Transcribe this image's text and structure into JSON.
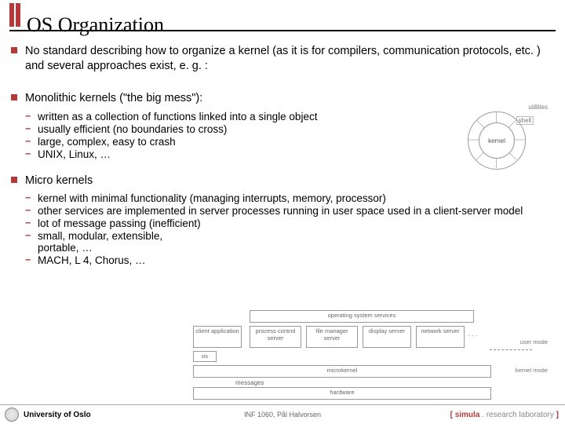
{
  "title": "OS Organization",
  "b1": "No standard describing how to organize a kernel (as it is for compilers, communication protocols, etc. ) and several approaches exist, e. g. :",
  "b2": "Monolithic kernels (\"the big mess\"):",
  "b2s": [
    "written as a collection of functions linked into a single object",
    "usually efficient (no boundaries to cross)",
    "large, complex, easy to crash",
    "UNIX, Linux, …"
  ],
  "b3": "Micro kernels",
  "b3s": [
    "kernel with minimal functionality (managing interrupts, memory, processor)",
    "other services are implemented in server processes running in user space used in a client-server model",
    "lot of message passing (inefficient)",
    "small, modular, extensible, portable, …",
    "MACH, L 4, Chorus, …"
  ],
  "d1": {
    "utilities": "utilities",
    "shell": "shell",
    "kernel": "kernel"
  },
  "d2": {
    "top": "operating system services",
    "ca": "client application",
    "pc": "process control server",
    "fm": "file manager server",
    "ds": "display server",
    "ns": "network server",
    "dots": "· · ·",
    "os": "os",
    "mk": "microkernel",
    "msg": "messages",
    "hw": "hardware",
    "um": "user mode",
    "km": "kernel mode"
  },
  "footer": {
    "uio": "University of Oslo",
    "mid": "INF 1060, Pål Halvorsen",
    "s1": "[ ",
    "s2": "simula",
    "s3": " . research laboratory ",
    "s4": "]"
  }
}
